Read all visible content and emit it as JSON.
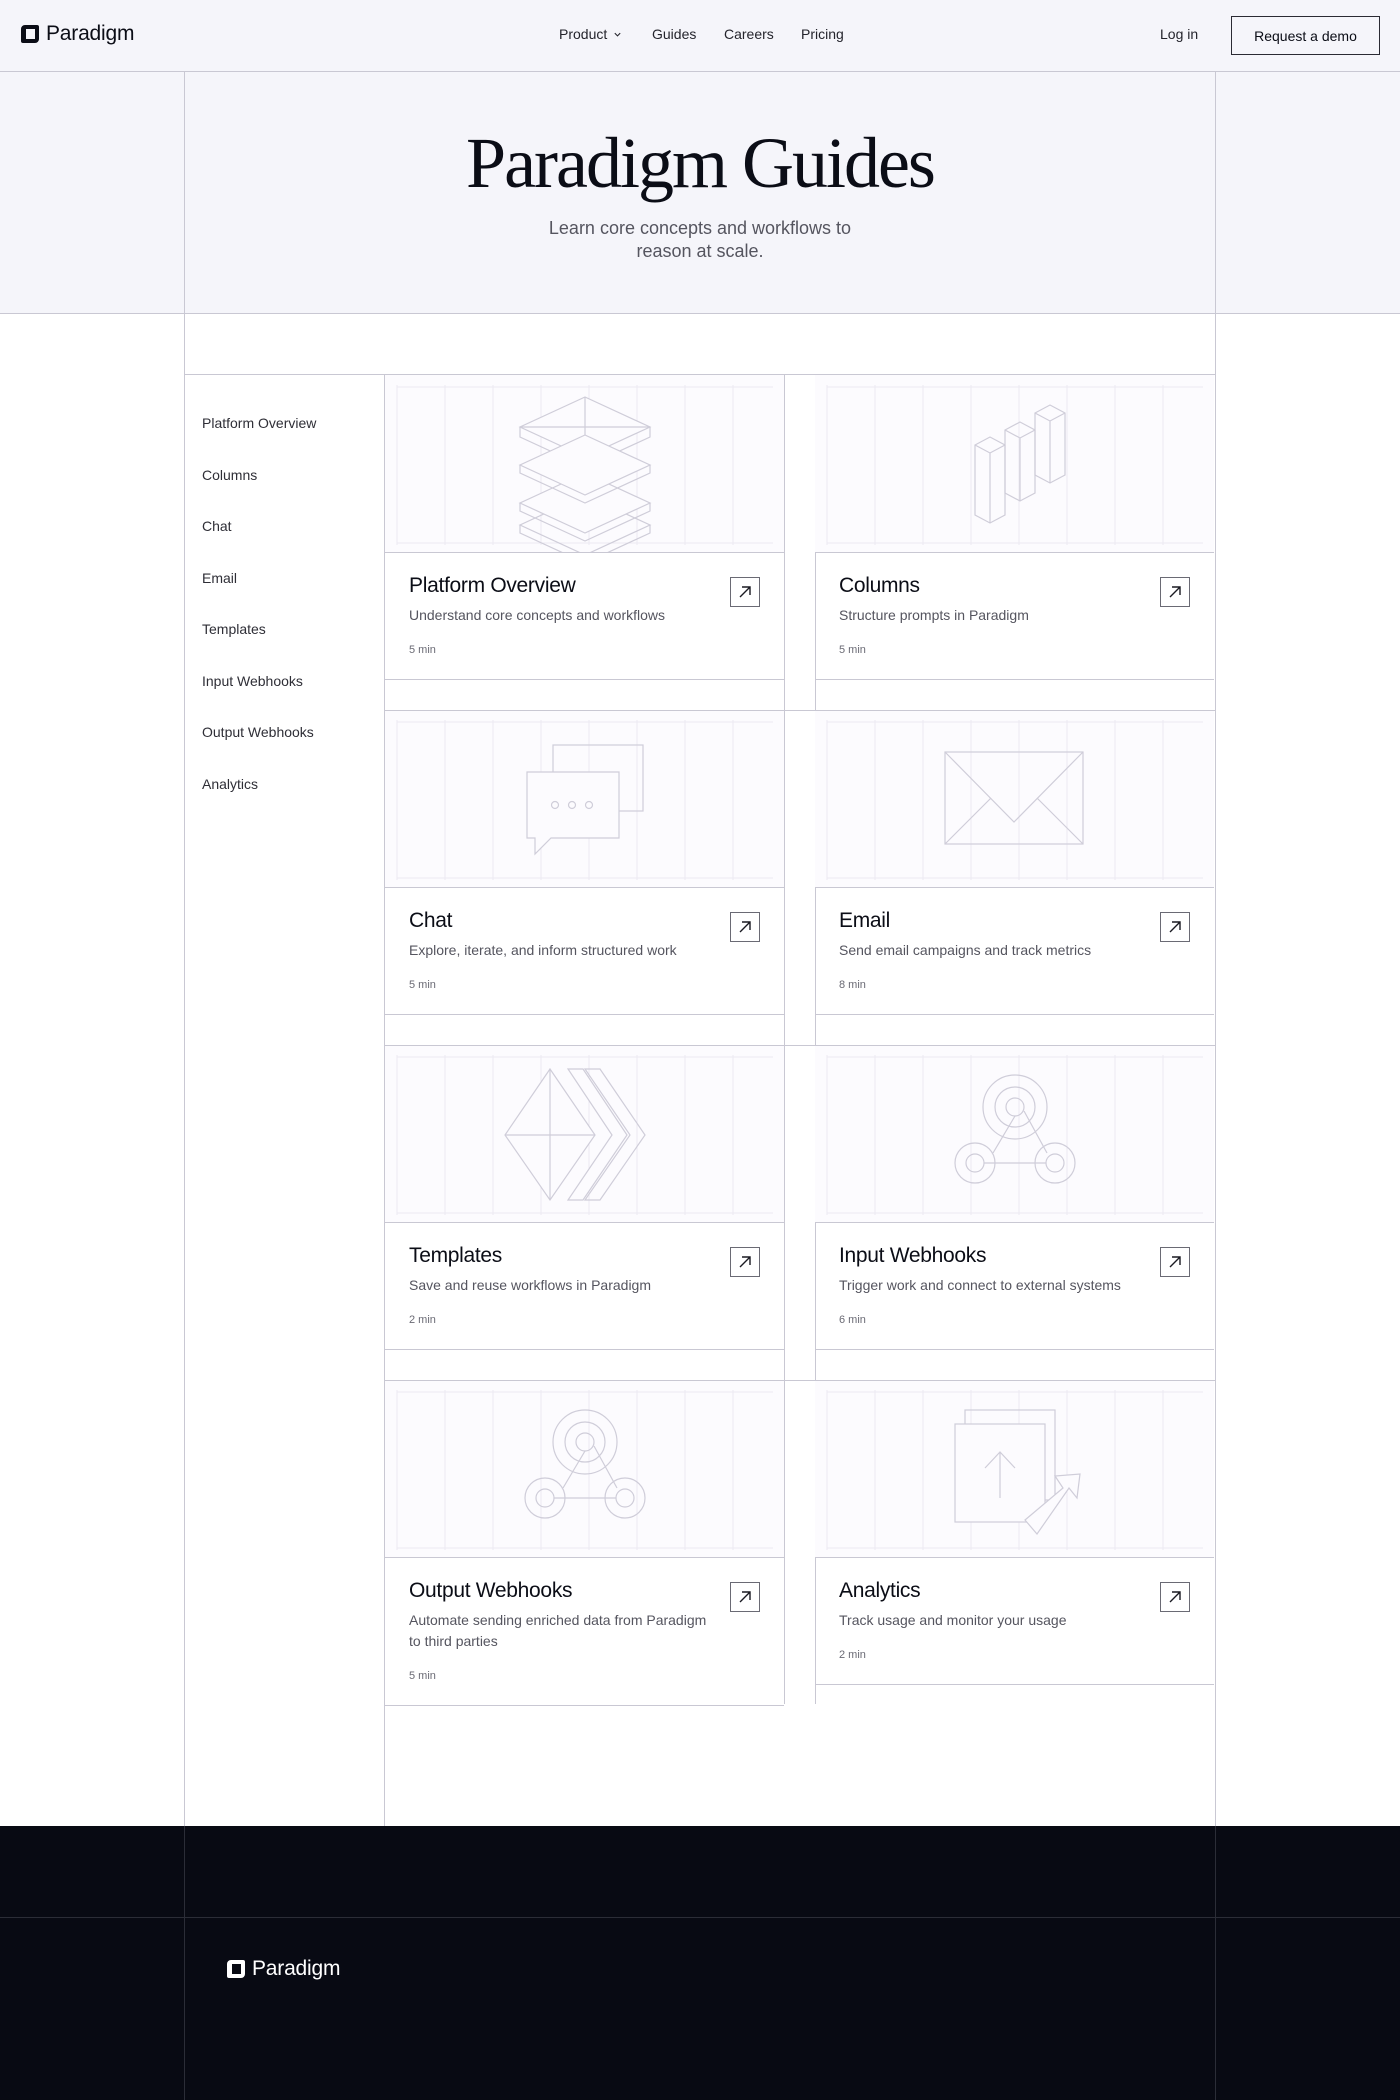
{
  "brand": {
    "name": "Paradigm"
  },
  "nav": {
    "product": "Product",
    "guides": "Guides",
    "careers": "Careers",
    "pricing": "Pricing",
    "login": "Log in",
    "demo": "Request a demo"
  },
  "hero": {
    "title": "Paradigm Guides",
    "subtitle": "Learn core concepts and workflows to reason at scale."
  },
  "sidebar": {
    "items": [
      {
        "label": "Platform Overview"
      },
      {
        "label": "Columns"
      },
      {
        "label": "Chat"
      },
      {
        "label": "Email"
      },
      {
        "label": "Templates"
      },
      {
        "label": "Input Webhooks"
      },
      {
        "label": "Output Webhooks"
      },
      {
        "label": "Analytics"
      }
    ]
  },
  "cards": [
    {
      "title": "Platform Overview",
      "desc": "Understand core concepts and workflows",
      "time": "5 min",
      "icon": "stacked-layers-icon"
    },
    {
      "title": "Columns",
      "desc": "Structure prompts in Paradigm",
      "time": "5 min",
      "icon": "columns-blocks-icon"
    },
    {
      "title": "Chat",
      "desc": "Explore, iterate, and inform structured work",
      "time": "5 min",
      "icon": "chat-bubbles-icon"
    },
    {
      "title": "Email",
      "desc": "Send email campaigns and track metrics",
      "time": "8 min",
      "icon": "envelope-icon"
    },
    {
      "title": "Templates",
      "desc": "Save and reuse workflows in Paradigm",
      "time": "2 min",
      "icon": "template-diamonds-icon"
    },
    {
      "title": "Input Webhooks",
      "desc": "Trigger work and connect to external systems",
      "time": "6 min",
      "icon": "webhook-icon"
    },
    {
      "title": "Output Webhooks",
      "desc": "Automate sending enriched data from Paradigm to third parties",
      "time": "5 min",
      "icon": "webhook-icon"
    },
    {
      "title": "Analytics",
      "desc": "Track usage and monitor your usage",
      "time": "2 min",
      "icon": "upload-share-icon"
    }
  ],
  "footer": {
    "brand": "Paradigm"
  }
}
